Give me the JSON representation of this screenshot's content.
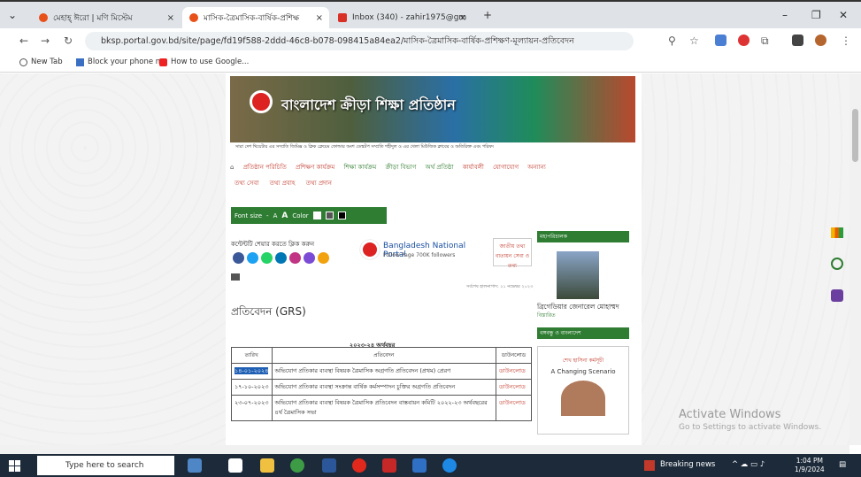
{
  "browser": {
    "tabs": [
      {
        "label": "মেহাহ্ ঈরো | মণি মিস্টেম",
        "x_label": "×"
      },
      {
        "label": "মাসিক-ত্রৈমাসিক-বার্ষিক-প্রশিক্ষ",
        "x_label": "×"
      },
      {
        "label": "Inbox (340) - zahir1975@gm",
        "x_label": "×"
      }
    ],
    "new_tab": "+",
    "url": "bksp.portal.gov.bd/site/page/fd19f588-2ddd-46c8-b078-098415a84ea2/মাসিক-ত্রৈমাসিক-বার্ষিক-প্রশিক্ষণ-মূল্যায়ন-প্রতিবেদন",
    "bookmarks": [
      "New Tab",
      "Block your phone n...",
      "How to use Google..."
    ]
  },
  "site": {
    "banner_title": "বাংলাদেশ ক্রীড়া শিক্ষা প্রতিষ্ঠান",
    "banner_strip": "সারা দেশ থিয়েটার এর সম্প্রতি জিমিক্স ও ক্লিক ক্লেয়েম ফোল্ডার অংশ ডেস্কটপ সম্প্রতি শহীদুল ও এর খেলা মিউজিক ক্লাবের ও অতিরিক্ত এবং পরিষদ",
    "menu": [
      "প্রতিষ্ঠান পরিচিতি",
      "প্রশিক্ষণ কার্যক্রম",
      "শিক্ষা কার্যক্রম",
      "ক্রীড়া বিভাগ",
      "অর্থ প্রতিষ্ঠা",
      "কার্যাবলী",
      "যোগাযোগ",
      "অন্যান্য"
    ],
    "menu2": [
      "তথ্য সেবা",
      "তথ্য প্রবাহ",
      "তথ্য প্রদান"
    ],
    "toolbar": {
      "font_size": "Font size",
      "minus": "-",
      "a1": "A",
      "a2": "A",
      "color": "Color"
    },
    "social_label": "কন্টেন্টটি শেয়ার করতে ক্লিক করুন",
    "portal": {
      "title": "Bangladesh National Portal",
      "sub": "Follow Page  700K followers"
    },
    "smallbox": "জাতীয় তথ্য বাতায়ন সেবা ও তথ্য",
    "updated": "সর্বশেষ হালনাগাদ: ২১ নভেম্বর ২০২৩",
    "page_heading": "প্রতিবেদন (GRS)",
    "table_caption": "২০২৩-২৪ অর্থবছর",
    "table_headers": [
      "তারিখ",
      "প্রতিবেদন",
      "ডাউনলোড"
    ],
    "rows": [
      {
        "date": "১৪-০১-২০২৪",
        "text": "অভিযোগ প্রতিকার ব্যবস্থা বিষয়ক ত্রৈমাসিক অগ্রগতি প্রতিবেদন (প্রথম) প্রেরণ",
        "dl": "ডাউনলোড"
      },
      {
        "date": "১৭-১০-২০২৩",
        "text": "অভিযোগ প্রতিকার ব্যবস্থা সংক্রান্ত বার্ষিক কর্মসম্পাদন চুক্তির অগ্রগতি প্রতিবেদন",
        "dl": "ডাউনলোড"
      },
      {
        "date": "২৩-০৭-২০২৩",
        "text": "অভিযোগ প্রতিকার ব্যবস্থা বিষয়ক ত্রৈমাসিক প্রতিবেদন বাস্তবায়ন কমিটি ২০২২-২৩ অর্থবছরের ৪র্থ ত্রৈমাসিক সভা",
        "dl": "ডাউনলোড"
      }
    ],
    "right": {
      "dg_title": "মহাপরিচালক",
      "dg_name": "ব্রিগেডিয়ার জেনারেল মোহাম্মদ",
      "dg_more": "বিস্তারিত",
      "book_title": "শেখ হাসিনা কর্মসূচী",
      "book_bar": "বঙ্গবন্ধু ও বাংলাদেশ",
      "book_sub": "A Changing Scenario"
    }
  },
  "watermark": {
    "line1": "Activate Windows",
    "line2": "Go to Settings to activate Windows."
  },
  "taskbar": {
    "search": "Type here to search",
    "news": "Breaking news",
    "time": "1:04 PM",
    "date": "1/9/2024"
  }
}
